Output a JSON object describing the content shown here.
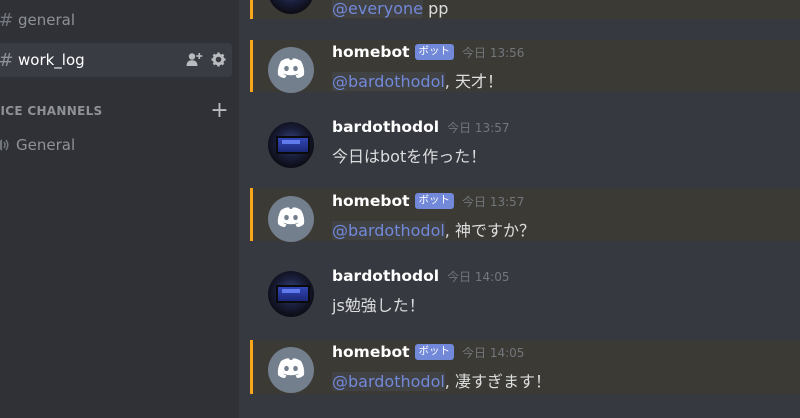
{
  "sidebar": {
    "channels": [
      {
        "name": "general",
        "active": false
      },
      {
        "name": "work_log",
        "active": true
      }
    ],
    "voice_category_label": "OICE CHANNELS",
    "voice_channels": [
      {
        "name": "General"
      }
    ]
  },
  "messages": [
    {
      "mention": "@everyone",
      "text": " pp"
    },
    {
      "author": "homebot",
      "tag": "ボット",
      "time": "今日 13:56",
      "mention": "@bardothodol",
      "text": ", 天才！",
      "bot": true
    },
    {
      "author": "bardothodol",
      "time": "今日 13:57",
      "text": "今日はbotを作った！",
      "bot": false
    },
    {
      "author": "homebot",
      "tag": "ボット",
      "time": "今日 13:57",
      "mention": "@bardothodol",
      "text": ", 神ですか？",
      "bot": true
    },
    {
      "author": "bardothodol",
      "time": "今日 14:05",
      "text": "js勉強した！",
      "bot": false
    },
    {
      "author": "homebot",
      "tag": "ボット",
      "time": "今日 14:05",
      "mention": "@bardothodol",
      "text": ", 凄すぎます！",
      "bot": true
    }
  ],
  "colors": {
    "sidebar_bg": "#2f3136",
    "chat_bg": "#36393f",
    "mention_highlight_bar": "#faa61a",
    "mention_text": "#7289da",
    "bot_tag_bg": "#7289da",
    "bot_avatar_bg": "#747f8d"
  },
  "icons": {
    "channel": "hash-icon",
    "invite": "add-member-icon",
    "settings": "gear-icon",
    "voice": "speaker-icon",
    "add_voice_channel": "plus-icon",
    "bot_avatar": "discord-logo-icon"
  }
}
